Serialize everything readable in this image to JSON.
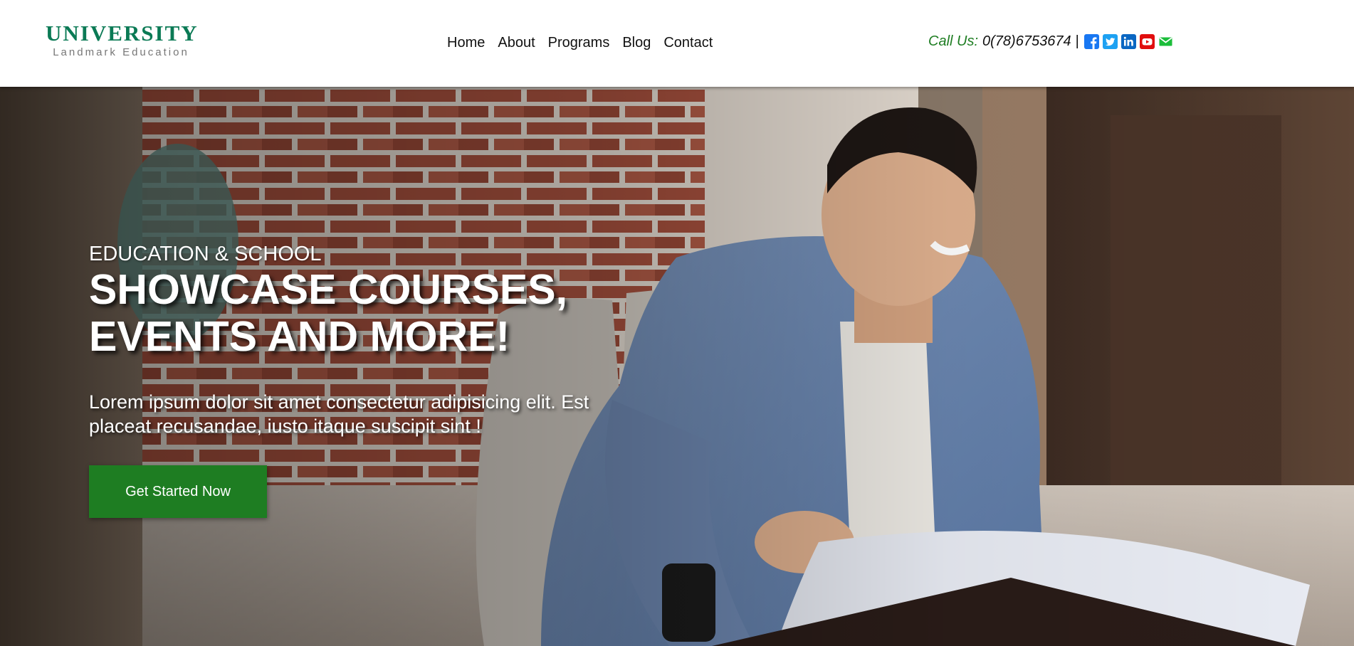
{
  "header": {
    "logo": {
      "title": "UNIVERSITY",
      "subtitle": "Landmark Education"
    },
    "nav": [
      {
        "label": "Home"
      },
      {
        "label": "About"
      },
      {
        "label": "Programs"
      },
      {
        "label": "Blog"
      },
      {
        "label": "Contact"
      }
    ],
    "contact": {
      "call_label": "Call Us:",
      "phone": "0(78)6753674",
      "separator": "|"
    },
    "social_icons": [
      "facebook-icon",
      "twitter-icon",
      "linkedin-icon",
      "youtube-icon",
      "mail-icon"
    ]
  },
  "hero": {
    "eyebrow": "EDUCATION & SCHOOL",
    "headline_line1": "SHOWCASE COURSES,",
    "headline_line2": "EVENTS AND MORE!",
    "body_line1": "Lorem ipsum dolor sit amet consectetur adipisicing elit. Est",
    "body_line2": "placeat recusandae, iusto itaque suscipit sint !",
    "cta_label": "Get Started Now"
  },
  "colors": {
    "brand_green": "#1e7d22",
    "logo_green": "#0b7a55",
    "facebook": "#1877f2",
    "twitter": "#1da1f2",
    "linkedin": "#0a66c2",
    "youtube": "#e10e0e",
    "mail": "#1bbd3a"
  }
}
